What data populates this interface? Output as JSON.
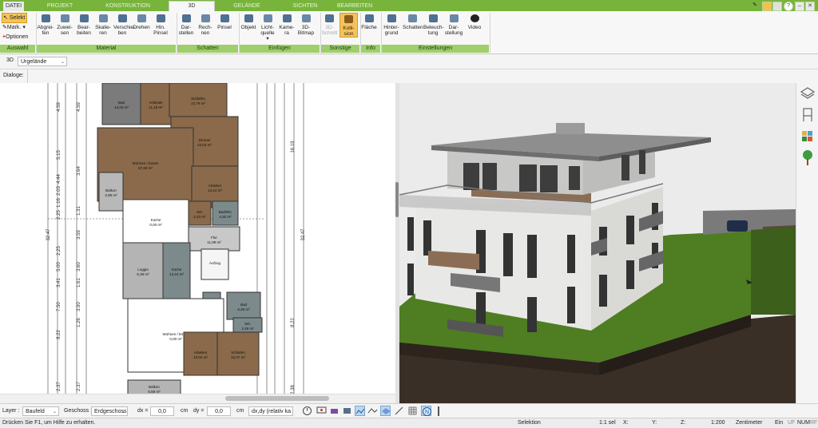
{
  "tabs": [
    "DATEI",
    "PROJEKT",
    "KONSTRUKTION",
    "3D",
    "GELÄNDE",
    "SICHTEN",
    "BEARBEITEN"
  ],
  "auswahl": {
    "items": [
      "Selekt",
      "Mark.",
      "Optionen"
    ],
    "label": "Auswahl"
  },
  "groups": {
    "material": {
      "label": "Material",
      "buttons": [
        [
          "Abgrei-",
          "fen"
        ],
        [
          "Zuwei-",
          "sen"
        ],
        [
          "Bear-",
          "beiten"
        ],
        [
          "Skalie-",
          "ren"
        ],
        [
          "Verschie-",
          "ben"
        ],
        [
          "Drehen",
          ""
        ],
        [
          "Hin.",
          "Pinsel"
        ]
      ]
    },
    "schatten": {
      "label": "Schatten",
      "buttons": [
        [
          "Dar-",
          "stellen"
        ],
        [
          "Rech-",
          "nen"
        ],
        [
          "Pinsel",
          ""
        ]
      ]
    },
    "einfuegen": {
      "label": "Einfügen",
      "buttons": [
        [
          "Objekt",
          ""
        ],
        [
          "Licht-",
          "quelle ▾"
        ],
        [
          "Kame-",
          "ra"
        ],
        [
          "3D-",
          "Bitmap"
        ]
      ]
    },
    "sonstige": {
      "label": "Sonstige",
      "buttons": [
        [
          "3D-",
          "Schnitt"
        ],
        [
          "Kolli-",
          "sion"
        ]
      ]
    },
    "info": {
      "label": "Info",
      "buttons": [
        [
          "Fläche",
          ""
        ]
      ]
    },
    "einstellungen": {
      "label": "Einstellungen",
      "buttons": [
        [
          "Hinter-",
          "grund"
        ],
        [
          "Schatten",
          ""
        ],
        [
          "Beleuch-",
          "tung"
        ],
        [
          "Dar-",
          "stellung"
        ],
        [
          "Video",
          ""
        ]
      ]
    }
  },
  "view_bar": {
    "mode": "3D",
    "terrain": "Urgelände"
  },
  "dialog_bar": {
    "label": "Dialoge:"
  },
  "layer_bar": {
    "layer_label": "Layer :",
    "layer_value": "Baufeld",
    "floor_label": "Geschoss :",
    "floor_value": "Erdgeschoss",
    "dx_label": "dx =",
    "dx_value": "0,0",
    "dx_unit": "cm",
    "dy_label": "dy =",
    "dy_value": "0,0",
    "dy_unit": "cm",
    "mode_value": "dx,dy (relativ ka"
  },
  "statusbar": {
    "help": "Drücken Sie F1, um Hilfe zu erhalten.",
    "mode": "Selektion",
    "scale_sel": "1:1 sel",
    "x": "X:",
    "y": "Y:",
    "z": "Z:",
    "scale": "1:200",
    "unit": "Zentimeter",
    "ein": "Ein",
    "uf": "UF",
    "num": "NUM",
    "rf": "RF"
  },
  "plan": {
    "rooms": [
      {
        "name": "Bad",
        "area": "14,02 m²"
      },
      {
        "name": "Ankleide",
        "area": "11,18 m²"
      },
      {
        "name": "Schlafen",
        "area": "22,79 m²"
      },
      {
        "name": "Zimmer",
        "area": "22,03 m²"
      },
      {
        "name": "Wohnen / Essen",
        "area": "57,89 m²"
      },
      {
        "name": "Arbeiten",
        "area": "14,24 m²"
      },
      {
        "name": "Balkon",
        "area": "2,89 m²"
      },
      {
        "name": "Küche",
        "area": "0,00 m²"
      },
      {
        "name": "WC",
        "area": "2,43 m²"
      },
      {
        "name": "Bad/WC",
        "area": "4,30 m²"
      },
      {
        "name": "Flur",
        "area": "11,99 m²"
      },
      {
        "name": "Loggia",
        "area": "6,38 m²"
      },
      {
        "name": "Küche",
        "area": "14,24 m²"
      },
      {
        "name": "Aufzug",
        "area": ""
      },
      {
        "name": "Abstell.",
        "area": "3,66 m²"
      },
      {
        "name": "Bad",
        "area": "6,26 m²"
      },
      {
        "name": "WC",
        "area": "2,49 m²"
      },
      {
        "name": "Wohnen / Essen",
        "area": "0,00 m²"
      },
      {
        "name": "Arbeiten",
        "area": "10,02 m²"
      },
      {
        "name": "Schlafen",
        "area": "15,07 m²"
      },
      {
        "name": "Balkon",
        "area": "5,58 m²"
      }
    ],
    "dims_left": [
      "4.59",
      "5.15",
      "4.44",
      "2.03",
      "1.16",
      "2.25",
      "2.25",
      "5.00",
      "3.41",
      "7.50",
      "8.22",
      "2.37"
    ],
    "dim_total_left": "32.47",
    "dims_mid": [
      "4.59",
      "3.64",
      "1.31",
      "3.59",
      "3.60",
      "1.61",
      "3.90",
      "1.26",
      "2.37"
    ],
    "dims_right": [
      "16.19",
      "32.47",
      "8.22",
      "2.38"
    ]
  },
  "colors": {
    "accent_green": "#78b43c",
    "group_green": "#9fce6b",
    "active_button": "#f5c35b"
  }
}
